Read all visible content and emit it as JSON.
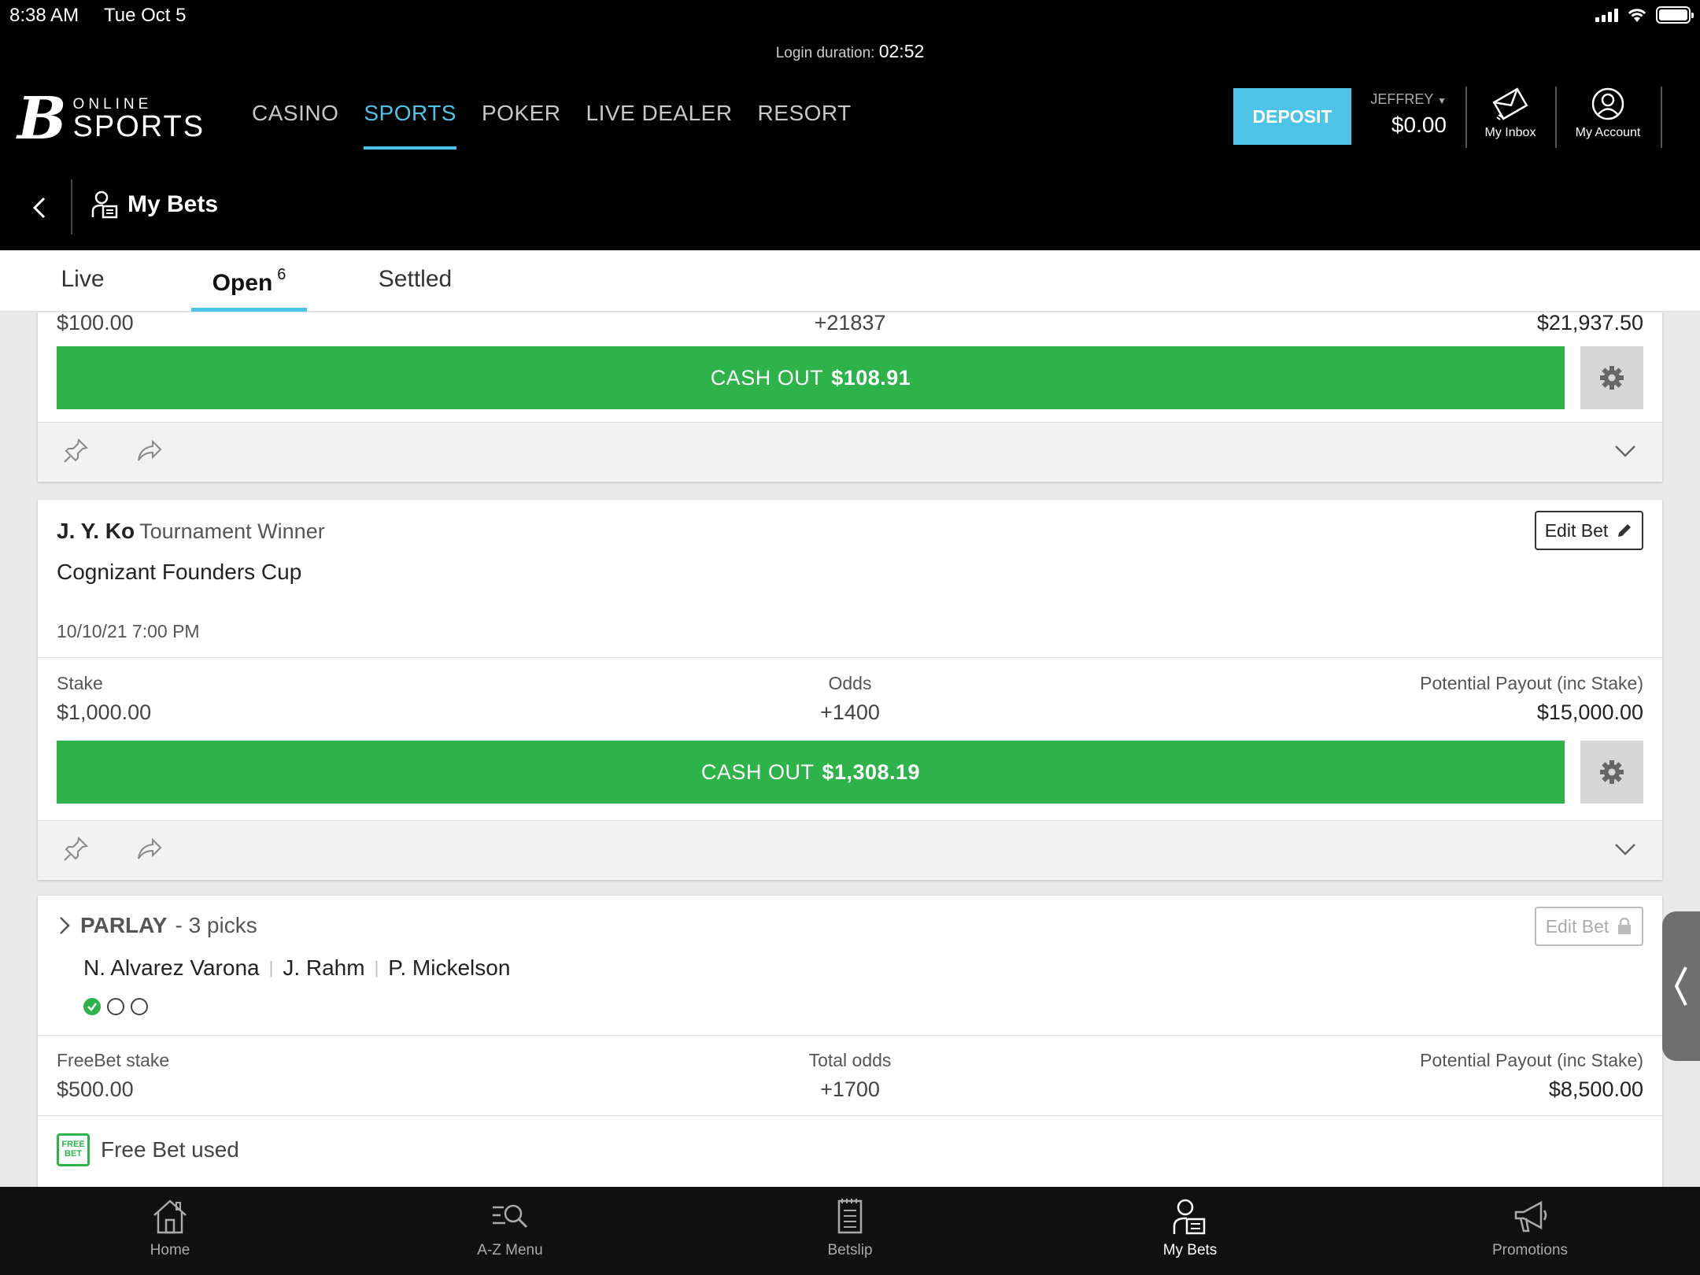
{
  "status": {
    "time": "8:38 AM",
    "date": "Tue Oct 5"
  },
  "header": {
    "login_label": "Login duration:",
    "login_duration": "02:52",
    "logo_b": "B",
    "logo_online": "ONLINE",
    "logo_sports": "SPORTS",
    "nav": [
      {
        "label": "CASINO",
        "active": false
      },
      {
        "label": "SPORTS",
        "active": true
      },
      {
        "label": "POKER",
        "active": false
      },
      {
        "label": "LIVE DEALER",
        "active": false
      },
      {
        "label": "RESORT",
        "active": false
      }
    ],
    "deposit_label": "DEPOSIT",
    "user_name": "JEFFREY",
    "balance": "$0.00",
    "inbox_label": "My Inbox",
    "account_label": "My Account",
    "accent_color": "#4ec3e8"
  },
  "subheader": {
    "title": "My Bets"
  },
  "tabs": [
    {
      "label": "Live",
      "count": ""
    },
    {
      "label": "Open",
      "count": "6"
    },
    {
      "label": "Settled",
      "count": ""
    }
  ],
  "bets": [
    {
      "stake_value": "$100.00",
      "odds_value": "+21837",
      "payout_value": "$21,937.50",
      "cashout_label": "CASH OUT",
      "cashout_amount": "$108.91"
    },
    {
      "selection": "J. Y. Ko",
      "market": "Tournament Winner",
      "event": "Cognizant Founders Cup",
      "date": "10/10/21 7:00 PM",
      "edit_label": "Edit Bet",
      "stake_label": "Stake",
      "stake_value": "$1,000.00",
      "odds_label": "Odds",
      "odds_value": "+1400",
      "payout_label": "Potential Payout (inc Stake)",
      "payout_value": "$15,000.00",
      "cashout_label": "CASH OUT",
      "cashout_amount": "$1,308.19"
    },
    {
      "type": "PARLAY",
      "picks_count": "- 3 picks",
      "edit_label": "Edit Bet",
      "picks": [
        "N. Alvarez Varona",
        "J. Rahm",
        "P. Mickelson"
      ],
      "pick_status": [
        "won",
        "open",
        "open"
      ],
      "stake_label": "FreeBet stake",
      "stake_value": "$500.00",
      "odds_label": "Total odds",
      "odds_value": "+1700",
      "payout_label": "Potential Payout (inc Stake)",
      "payout_value": "$8,500.00",
      "freebet_badge_top": "FREE",
      "freebet_badge_bottom": "BET",
      "freebet_text": "Free Bet used"
    }
  ],
  "bottom_nav": [
    {
      "label": "Home",
      "icon": "home-icon",
      "active": false
    },
    {
      "label": "A-Z Menu",
      "icon": "az-menu-icon",
      "active": false
    },
    {
      "label": "Betslip",
      "icon": "betslip-icon",
      "active": false
    },
    {
      "label": "My Bets",
      "icon": "my-bets-icon",
      "active": true
    },
    {
      "label": "Promotions",
      "icon": "megaphone-icon",
      "active": false
    }
  ],
  "colors": {
    "cashout_green": "#2db34a",
    "header_bg": "#000000"
  }
}
